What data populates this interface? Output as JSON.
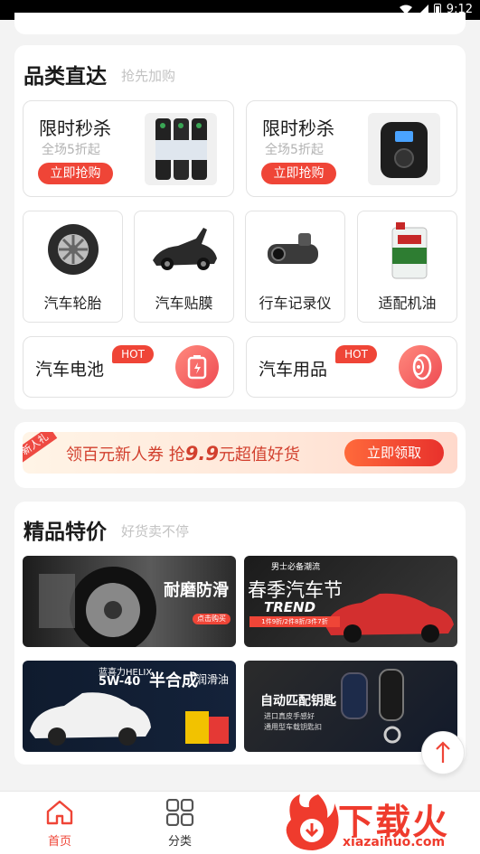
{
  "status_bar": {
    "time": "9:12"
  },
  "categories_section": {
    "title": "品类直达",
    "subtitle": "抢先加购",
    "flash_sales": [
      {
        "title": "限时秒杀",
        "subtitle": "全场5折起",
        "button": "立即抢购",
        "image": "spray-cans"
      },
      {
        "title": "限时秒杀",
        "subtitle": "全场5折起",
        "button": "立即抢购",
        "image": "air-compressor"
      }
    ],
    "items": [
      {
        "label": "汽车轮胎",
        "icon": "tire-icon"
      },
      {
        "label": "汽车贴膜",
        "icon": "sports-car-icon"
      },
      {
        "label": "行车记录仪",
        "icon": "dashcam-icon"
      },
      {
        "label": "适配机油",
        "icon": "engine-oil-icon"
      }
    ],
    "hot_items": [
      {
        "label": "汽车电池",
        "badge": "HOT",
        "icon": "battery-icon"
      },
      {
        "label": "汽车用品",
        "badge": "HOT",
        "icon": "wheel-icon"
      }
    ]
  },
  "coupon_banner": {
    "badge": "新人礼",
    "text_before": "领百元新人券 抢",
    "highlight": "9.9",
    "text_after": "元超值好货",
    "button": "立即领取"
  },
  "featured_section": {
    "title": "精品特价",
    "subtitle": "好货卖不停",
    "promos": [
      {
        "caption": "耐磨防滑",
        "tag": "点击购买"
      },
      {
        "top": "男士必备潮流",
        "caption": "春季汽车节",
        "trend": "TREND",
        "tag": "1件9折/2件8折/3件7折"
      },
      {
        "brand": "蓝喜力HELIX",
        "spec": "5W-40",
        "caption": "半合成",
        "caption2": "润滑油"
      },
      {
        "caption": "自动匹配钥匙",
        "line1": "进口真皮手感好",
        "line2": "通用型车载钥匙扣"
      }
    ]
  },
  "tab_bar": {
    "tabs": [
      {
        "label": "首页",
        "active": true
      },
      {
        "label": "分类",
        "active": false
      }
    ]
  },
  "watermark": {
    "text": "下载火",
    "url": "xiazaihuo.com"
  },
  "colors": {
    "accent": "#ef4537",
    "text": "#1a1a1a",
    "muted": "#b3b3b3"
  }
}
